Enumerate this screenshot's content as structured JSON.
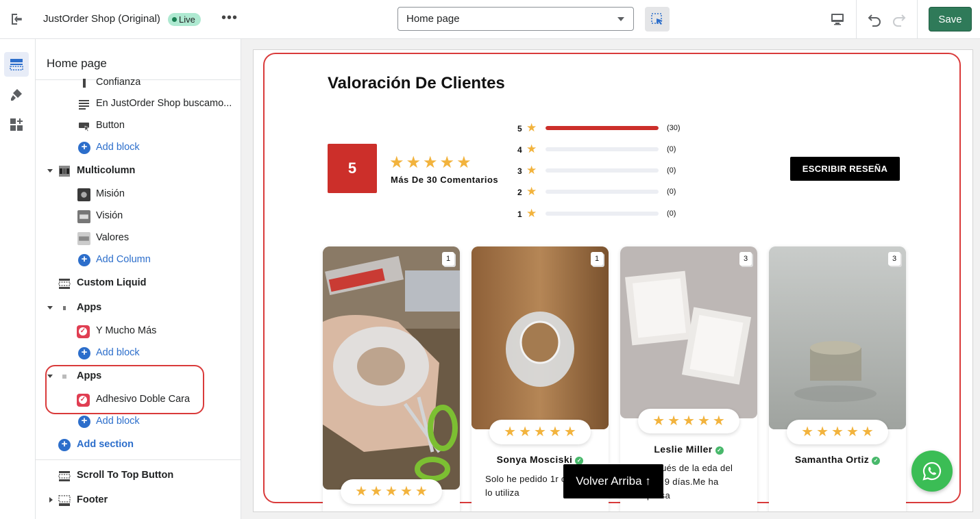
{
  "topbar": {
    "shop_name": "JustOrder Shop (Original)",
    "live_badge": "Live",
    "page_select_value": "Home page",
    "save_label": "Save"
  },
  "sidebar": {
    "title": "Home page",
    "rows": {
      "confianza": "Confianza",
      "text_block": "En JustOrder Shop buscamo...",
      "button": "Button",
      "add_block_1": "Add block",
      "multicolumn": "Multicolumn",
      "mision": "Misión",
      "vision": "Visión",
      "valores": "Valores",
      "add_column": "Add Column",
      "custom_liquid": "Custom Liquid",
      "apps_1": "Apps",
      "y_mucho_mas": "Y Mucho Más",
      "add_block_2": "Add block",
      "apps_2": "Apps",
      "adhesivo": "Adhesivo Doble Cara",
      "add_block_3": "Add block",
      "add_section": "Add section",
      "scroll_to_top": "Scroll To Top Button",
      "footer": "Footer"
    }
  },
  "reviews": {
    "title": "Valoración De Clientes",
    "score": "5",
    "comments_label": "Más De 30 Comentarios",
    "write_button": "ESCRIBIR RESEÑA",
    "distribution": [
      {
        "stars": "5",
        "count": "(30)",
        "fraction": 1.0
      },
      {
        "stars": "4",
        "count": "(0)",
        "fraction": 0
      },
      {
        "stars": "3",
        "count": "(0)",
        "fraction": 0
      },
      {
        "stars": "2",
        "count": "(0)",
        "fraction": 0
      },
      {
        "stars": "1",
        "count": "(0)",
        "fraction": 0
      }
    ],
    "cards": [
      {
        "count": "1",
        "name": "",
        "text": ""
      },
      {
        "count": "1",
        "name": "Sonya Mosciski",
        "text": "Solo he pedido 1r creo que lo utiliza"
      },
      {
        "count": "3",
        "name": "Leslie Miller",
        "text": "s después de la eda del pedido 9 días.Me ha sorpresa"
      },
      {
        "count": "3",
        "name": "Samantha Ortiz",
        "text": ""
      }
    ]
  },
  "overlay": {
    "scroll_top_label": "Volver Arriba ↑"
  },
  "colors": {
    "accent_red": "#cc2f2a",
    "star": "#f2b33d",
    "save_green": "#2f7a59",
    "link_blue": "#2c6ecb",
    "whatsapp_green": "#3bbd55"
  }
}
